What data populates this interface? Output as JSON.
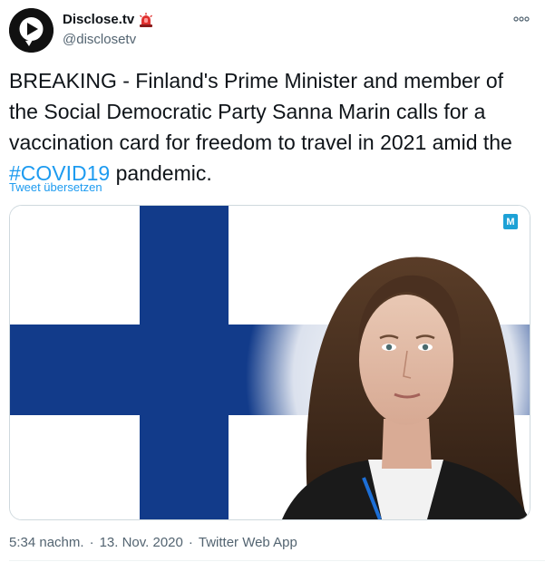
{
  "author": {
    "display_name": "Disclose.tv",
    "verified_badge_icon": "police-siren-emoji",
    "handle": "@disclosetv",
    "avatar_icon": "disclose-tv-logo-icon"
  },
  "tweet": {
    "text_before_hashtag": "BREAKING - Finland's Prime Minister and member of the Social Democratic Party Sanna Marin calls for a vaccination card for freedom to travel in 2021 amid the ",
    "hashtag": "#COVID19",
    "text_after_hashtag": " pandemic.",
    "translate_label": "Tweet übersetzen"
  },
  "media": {
    "description_icon": "finnish-flag-portrait-photo",
    "corner_badge_letter": "M",
    "colors": {
      "flag_blue": "#123b8a",
      "flag_white": "#ffffff",
      "badge": "#1da1d6"
    }
  },
  "meta": {
    "time": "5:34 nachm.",
    "date": "13. Nov. 2020",
    "source": "Twitter Web App",
    "separator": "·"
  },
  "colors": {
    "link": "#1d9bf0",
    "secondary_text": "#536471",
    "primary_text": "#0f1419"
  }
}
